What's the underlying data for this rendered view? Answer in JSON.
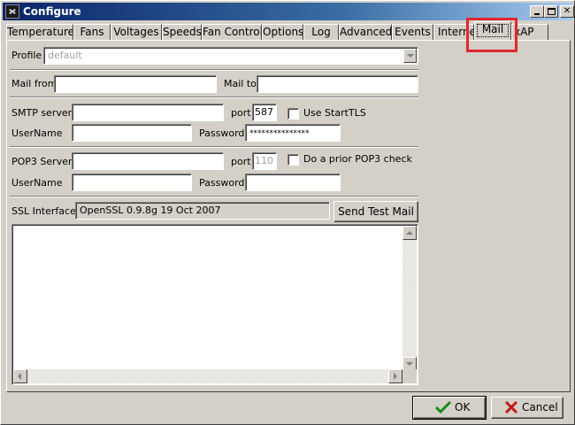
{
  "window": {
    "title": "Configure",
    "minimize_icon": "minimize-icon",
    "maximize_icon": "maximize-icon",
    "close_glyph": "✕"
  },
  "tabs": [
    {
      "label": "Temperatures"
    },
    {
      "label": "Fans"
    },
    {
      "label": "Voltages"
    },
    {
      "label": "Speeds"
    },
    {
      "label": "Fan Control"
    },
    {
      "label": "Options"
    },
    {
      "label": "Log"
    },
    {
      "label": "Advanced"
    },
    {
      "label": "Events"
    },
    {
      "label": "Interne"
    },
    {
      "label": "Mail",
      "active": true
    },
    {
      "label": "xAP"
    }
  ],
  "highlight_color": "#e0282e",
  "profile": {
    "label": "Profile",
    "value": "default"
  },
  "mail": {
    "from_label": "Mail from",
    "from_value": "",
    "to_label": "Mail to",
    "to_value": ""
  },
  "smtp": {
    "server_label": "SMTP server",
    "server_value": "",
    "port_label": "port",
    "port_value": "587",
    "starttls_label": "Use StartTLS",
    "starttls_checked": false,
    "username_label": "UserName",
    "username_value": "",
    "password_label": "Password",
    "password_value": "***************"
  },
  "pop3": {
    "server_label": "POP3 Server",
    "server_value": "",
    "port_label": "port",
    "port_value": "110",
    "prior_check_label": "Do a prior POP3 check",
    "prior_check_checked": false,
    "username_label": "UserName",
    "username_value": "",
    "password_label": "Password",
    "password_value": ""
  },
  "ssl": {
    "label": "SSL Interface",
    "value": "OpenSSL 0.9.8g 19 Oct 2007",
    "send_test_label": "Send Test Mail"
  },
  "log_text": "",
  "footer": {
    "ok_label": "OK",
    "cancel_label": "Cancel",
    "ok_color": "#1a8a1a",
    "cancel_color": "#c01818"
  }
}
